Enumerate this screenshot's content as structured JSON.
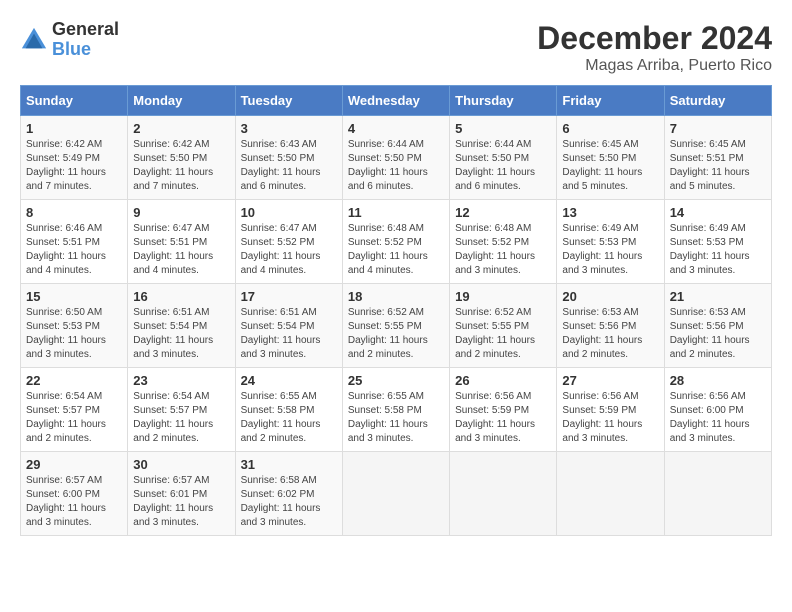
{
  "header": {
    "logo_line1": "General",
    "logo_line2": "Blue",
    "month_title": "December 2024",
    "location": "Magas Arriba, Puerto Rico"
  },
  "days_of_week": [
    "Sunday",
    "Monday",
    "Tuesday",
    "Wednesday",
    "Thursday",
    "Friday",
    "Saturday"
  ],
  "weeks": [
    [
      {
        "num": "1",
        "sunrise": "6:42 AM",
        "sunset": "5:49 PM",
        "daylight": "11 hours and 7 minutes."
      },
      {
        "num": "2",
        "sunrise": "6:42 AM",
        "sunset": "5:50 PM",
        "daylight": "11 hours and 7 minutes."
      },
      {
        "num": "3",
        "sunrise": "6:43 AM",
        "sunset": "5:50 PM",
        "daylight": "11 hours and 6 minutes."
      },
      {
        "num": "4",
        "sunrise": "6:44 AM",
        "sunset": "5:50 PM",
        "daylight": "11 hours and 6 minutes."
      },
      {
        "num": "5",
        "sunrise": "6:44 AM",
        "sunset": "5:50 PM",
        "daylight": "11 hours and 6 minutes."
      },
      {
        "num": "6",
        "sunrise": "6:45 AM",
        "sunset": "5:50 PM",
        "daylight": "11 hours and 5 minutes."
      },
      {
        "num": "7",
        "sunrise": "6:45 AM",
        "sunset": "5:51 PM",
        "daylight": "11 hours and 5 minutes."
      }
    ],
    [
      {
        "num": "8",
        "sunrise": "6:46 AM",
        "sunset": "5:51 PM",
        "daylight": "11 hours and 4 minutes."
      },
      {
        "num": "9",
        "sunrise": "6:47 AM",
        "sunset": "5:51 PM",
        "daylight": "11 hours and 4 minutes."
      },
      {
        "num": "10",
        "sunrise": "6:47 AM",
        "sunset": "5:52 PM",
        "daylight": "11 hours and 4 minutes."
      },
      {
        "num": "11",
        "sunrise": "6:48 AM",
        "sunset": "5:52 PM",
        "daylight": "11 hours and 4 minutes."
      },
      {
        "num": "12",
        "sunrise": "6:48 AM",
        "sunset": "5:52 PM",
        "daylight": "11 hours and 3 minutes."
      },
      {
        "num": "13",
        "sunrise": "6:49 AM",
        "sunset": "5:53 PM",
        "daylight": "11 hours and 3 minutes."
      },
      {
        "num": "14",
        "sunrise": "6:49 AM",
        "sunset": "5:53 PM",
        "daylight": "11 hours and 3 minutes."
      }
    ],
    [
      {
        "num": "15",
        "sunrise": "6:50 AM",
        "sunset": "5:53 PM",
        "daylight": "11 hours and 3 minutes."
      },
      {
        "num": "16",
        "sunrise": "6:51 AM",
        "sunset": "5:54 PM",
        "daylight": "11 hours and 3 minutes."
      },
      {
        "num": "17",
        "sunrise": "6:51 AM",
        "sunset": "5:54 PM",
        "daylight": "11 hours and 3 minutes."
      },
      {
        "num": "18",
        "sunrise": "6:52 AM",
        "sunset": "5:55 PM",
        "daylight": "11 hours and 2 minutes."
      },
      {
        "num": "19",
        "sunrise": "6:52 AM",
        "sunset": "5:55 PM",
        "daylight": "11 hours and 2 minutes."
      },
      {
        "num": "20",
        "sunrise": "6:53 AM",
        "sunset": "5:56 PM",
        "daylight": "11 hours and 2 minutes."
      },
      {
        "num": "21",
        "sunrise": "6:53 AM",
        "sunset": "5:56 PM",
        "daylight": "11 hours and 2 minutes."
      }
    ],
    [
      {
        "num": "22",
        "sunrise": "6:54 AM",
        "sunset": "5:57 PM",
        "daylight": "11 hours and 2 minutes."
      },
      {
        "num": "23",
        "sunrise": "6:54 AM",
        "sunset": "5:57 PM",
        "daylight": "11 hours and 2 minutes."
      },
      {
        "num": "24",
        "sunrise": "6:55 AM",
        "sunset": "5:58 PM",
        "daylight": "11 hours and 2 minutes."
      },
      {
        "num": "25",
        "sunrise": "6:55 AM",
        "sunset": "5:58 PM",
        "daylight": "11 hours and 3 minutes."
      },
      {
        "num": "26",
        "sunrise": "6:56 AM",
        "sunset": "5:59 PM",
        "daylight": "11 hours and 3 minutes."
      },
      {
        "num": "27",
        "sunrise": "6:56 AM",
        "sunset": "5:59 PM",
        "daylight": "11 hours and 3 minutes."
      },
      {
        "num": "28",
        "sunrise": "6:56 AM",
        "sunset": "6:00 PM",
        "daylight": "11 hours and 3 minutes."
      }
    ],
    [
      {
        "num": "29",
        "sunrise": "6:57 AM",
        "sunset": "6:00 PM",
        "daylight": "11 hours and 3 minutes."
      },
      {
        "num": "30",
        "sunrise": "6:57 AM",
        "sunset": "6:01 PM",
        "daylight": "11 hours and 3 minutes."
      },
      {
        "num": "31",
        "sunrise": "6:58 AM",
        "sunset": "6:02 PM",
        "daylight": "11 hours and 3 minutes."
      },
      null,
      null,
      null,
      null
    ]
  ]
}
